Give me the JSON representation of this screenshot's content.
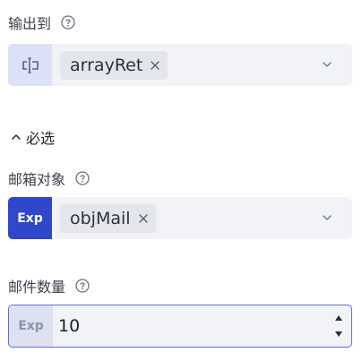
{
  "output_to": {
    "label": "输出到",
    "tag_value": "arrayRet"
  },
  "required_section": {
    "label": "必选"
  },
  "mail_object": {
    "label": "邮箱对象",
    "prefix": "Exp",
    "tag_value": "objMail"
  },
  "mail_count": {
    "label": "邮件数量",
    "prefix": "Exp",
    "value": "10"
  },
  "colors": {
    "accent": "#2f47c9",
    "field_bg": "#f2f3f7",
    "focus_border": "#5b6fd6"
  }
}
